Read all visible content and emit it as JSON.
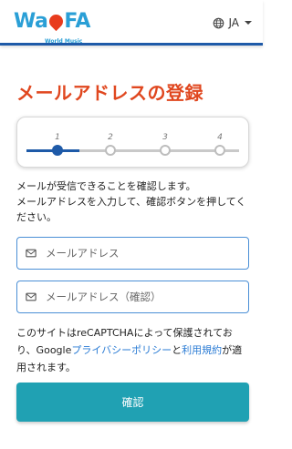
{
  "header": {
    "logo_text_a": "Wa",
    "logo_text_b": "FA",
    "logo_tagline": "World Music",
    "language": "JA"
  },
  "page": {
    "title": "メールアドレスの登録"
  },
  "stepper": {
    "steps": [
      "1",
      "2",
      "3",
      "4"
    ],
    "current": 1,
    "active_color": "#1e5aa8"
  },
  "instructions": {
    "line1": "メールが受信できることを確認します。",
    "line2": "メールアドレスを入力して、確認ボタンを押してください。"
  },
  "form": {
    "email_placeholder": "メールアドレス",
    "email_confirm_placeholder": "メールアドレス（確認）",
    "submit_label": "確認"
  },
  "recaptcha": {
    "prefix": "このサイトはreCAPTCHAによって保護されており、Google",
    "privacy_link": "プライバシーポリシー",
    "middle": "と",
    "terms_link": "利用規約",
    "suffix": "が適用されます。"
  },
  "colors": {
    "accent_red": "#e0471f",
    "header_border": "#1e5aa8",
    "button": "#20a1b3",
    "link": "#2a7bd4"
  }
}
